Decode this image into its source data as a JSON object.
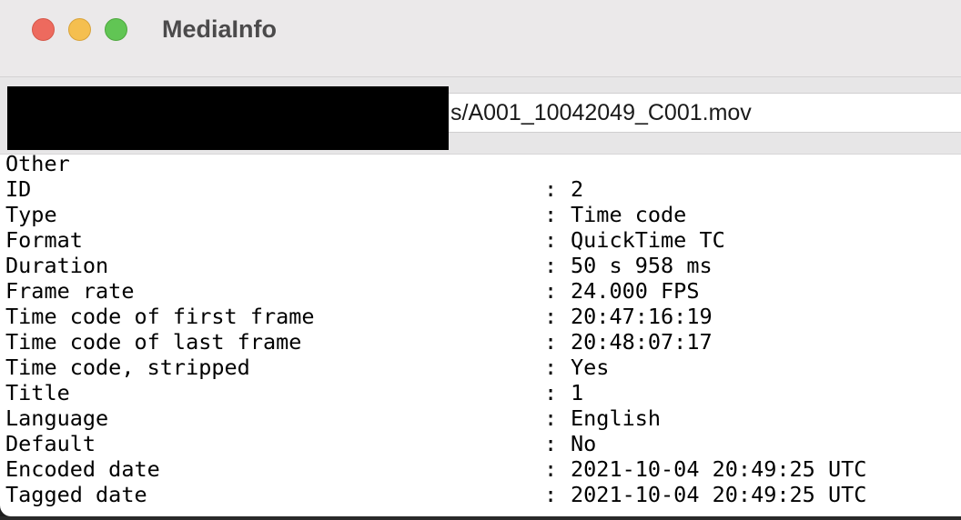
{
  "window": {
    "title": "MediaInfo"
  },
  "path_field": {
    "visible_text": "s/A001_10042049_C001.mov"
  },
  "report": {
    "section": "Other",
    "separator": ":",
    "rows": [
      {
        "label": "ID",
        "value": "2"
      },
      {
        "label": "Type",
        "value": "Time code"
      },
      {
        "label": "Format",
        "value": "QuickTime TC"
      },
      {
        "label": "Duration",
        "value": "50 s 958 ms"
      },
      {
        "label": "Frame rate",
        "value": "24.000 FPS"
      },
      {
        "label": "Time code of first frame",
        "value": "20:47:16:19"
      },
      {
        "label": "Time code of last frame",
        "value": "20:48:07:17"
      },
      {
        "label": "Time code, stripped",
        "value": "Yes"
      },
      {
        "label": "Title",
        "value": "1"
      },
      {
        "label": "Language",
        "value": "English"
      },
      {
        "label": "Default",
        "value": "No"
      },
      {
        "label": "Encoded date",
        "value": "2021-10-04 20:49:25 UTC"
      },
      {
        "label": "Tagged date",
        "value": "2021-10-04 20:49:25 UTC"
      }
    ]
  },
  "colors": {
    "close": "#ed6a5e",
    "minimize": "#f5bf4f",
    "zoom": "#61c554",
    "redaction": "#000000"
  }
}
